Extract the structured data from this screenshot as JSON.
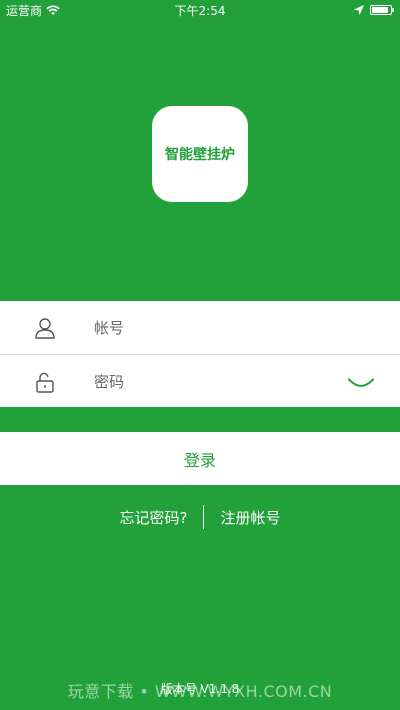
{
  "status_bar": {
    "carrier": "运营商",
    "time": "下午2:54",
    "battery_level": 0.9
  },
  "app_icon": {
    "label": "智能壁挂炉"
  },
  "login_form": {
    "account_placeholder": "帐号",
    "password_placeholder": "密码"
  },
  "login_button": {
    "label": "登录"
  },
  "links": {
    "forgot_password": "忘记密码?",
    "register": "注册帐号"
  },
  "footer": {
    "version": "版本号 V1.1.8",
    "watermark": "玩意下载 • WWW.WYXH.COM.CN"
  },
  "colors": {
    "brand_green": "#22a03a"
  }
}
